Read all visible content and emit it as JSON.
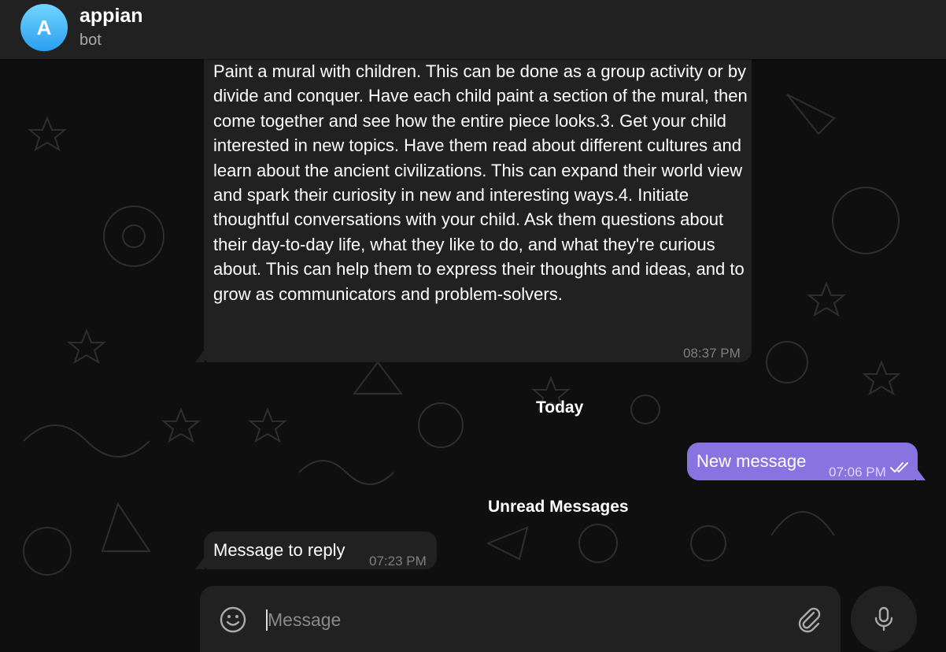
{
  "header": {
    "avatar_letter": "A",
    "title": "appian",
    "status": "bot"
  },
  "messages": [
    {
      "direction": "incoming",
      "text": "Paint a mural with children. This can be done as a group activity or by divide and conquer. Have each child paint a section of the mural, then come together and see how the entire piece looks.3. Get your child interested in new topics. Have them read about different cultures and learn about the ancient civilizations. This can expand their world view and spark their curiosity in new and interesting ways.4. Initiate thoughtful conversations with your child. Ask them questions about their day-to-day life, what they like to do, and what they're curious about. This can help them to express their thoughts and ideas, and to grow as communicators and problem-solvers.",
      "time": "08:37 PM"
    },
    {
      "direction": "outgoing",
      "text": "New message",
      "time": "07:06 PM",
      "status_icon": "double-check-icon"
    },
    {
      "direction": "incoming",
      "text": "Message to reply",
      "time": "07:23 PM"
    }
  ],
  "separators": {
    "date": "Today",
    "unread": "Unread Messages"
  },
  "composer": {
    "placeholder": "Message",
    "value": "",
    "emoji_icon": "smiley-icon",
    "attach_icon": "paperclip-icon",
    "send_icon": "microphone-icon"
  },
  "colors": {
    "background": "#0f0f0f",
    "panel": "#212121",
    "outgoing_bubble": "#8774e1",
    "avatar_gradient_top": "#72d5fd",
    "avatar_gradient_bottom": "#2a9ef1"
  }
}
